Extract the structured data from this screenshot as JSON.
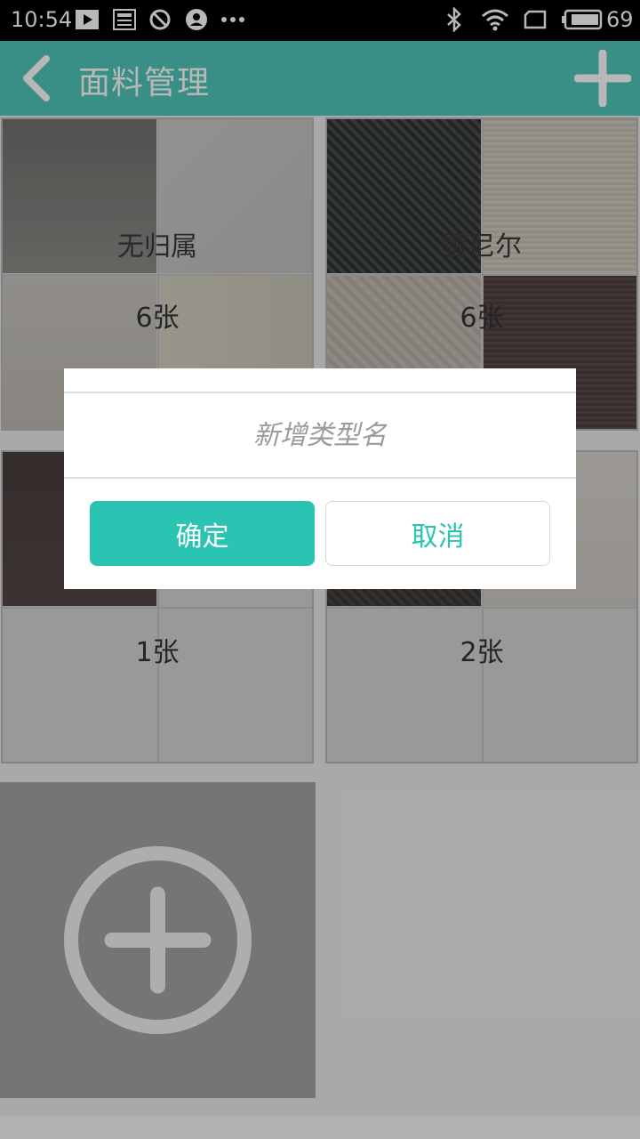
{
  "status_bar": {
    "time": "10:54",
    "battery": "69",
    "icons": [
      "play-icon",
      "news-icon",
      "block-icon",
      "account-icon",
      "more-dots-icon",
      "bluetooth-icon",
      "wifi-icon",
      "screen-icon",
      "battery-icon"
    ]
  },
  "header": {
    "title": "面料管理",
    "back_icon": "back-chevron-icon",
    "add_icon": "plus-icon",
    "color": "#4fc7b9"
  },
  "categories": [
    {
      "name": "无归属",
      "count": "6张",
      "swatches": [
        "#7a7d79",
        "#c6c8c5",
        "#c2beb7",
        "#cfcbbd"
      ]
    },
    {
      "name": "雪尼尔",
      "count": "6张",
      "swatches": [
        "#3b3d3d",
        "#cdc6bb",
        "#c0b7af",
        "#564646"
      ]
    },
    {
      "name": "",
      "count": "1张",
      "swatches": [
        "#4d4141",
        "#d5d5d5",
        "#d5d5d5",
        "#d5d5d5"
      ]
    },
    {
      "name": "",
      "count": "2张",
      "swatches": [
        "#3f3a38",
        "#d6d2cd",
        "#d5d5d5",
        "#d5d5d5"
      ]
    }
  ],
  "add_category": {
    "icon": "circle-plus-icon"
  },
  "dialog": {
    "input_placeholder": "新增类型名",
    "input_value": "",
    "confirm_label": "确定",
    "cancel_label": "取消",
    "accent": "#2bc4b3"
  }
}
